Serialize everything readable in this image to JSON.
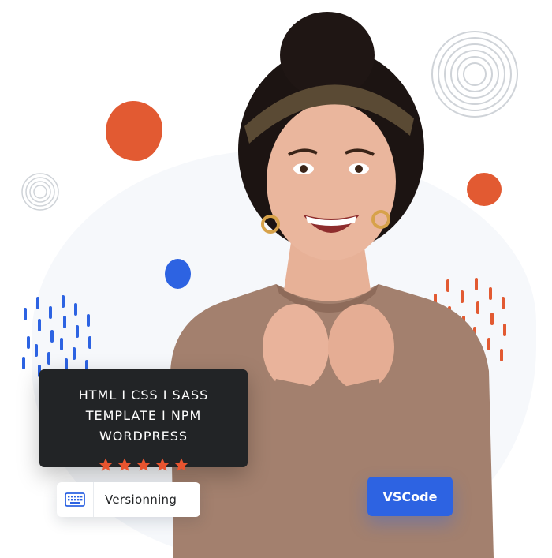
{
  "tech_card": {
    "lines": [
      "HTML I CSS I SASS",
      "TEMPLATE I NPM",
      "WORDPRESS"
    ]
  },
  "rating": {
    "value": 5,
    "max": 5,
    "star_color": "#e8542f"
  },
  "badges": {
    "versioning_label": "Versionning",
    "vscode_label": "VSCode"
  },
  "colors": {
    "accent_orange": "#e25a32",
    "accent_blue": "#2d63e2",
    "card_dark": "#222426",
    "sweater": "#a3806e"
  },
  "icons": [
    "keyboard-icon",
    "star-icon"
  ]
}
